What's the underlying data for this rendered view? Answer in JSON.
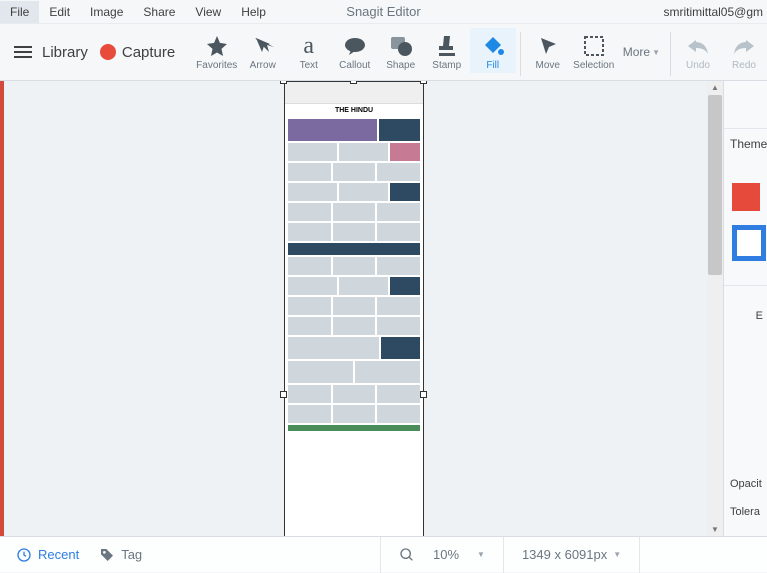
{
  "menubar": {
    "items": [
      "File",
      "Edit",
      "Image",
      "Share",
      "View",
      "Help"
    ],
    "title": "Snagit Editor",
    "user": "smritimittal05@gm"
  },
  "left_tools": {
    "library": "Library",
    "capture": "Capture"
  },
  "tools": [
    {
      "name": "favorites",
      "label": "Favorites"
    },
    {
      "name": "arrow",
      "label": "Arrow"
    },
    {
      "name": "text",
      "label": "Text"
    },
    {
      "name": "callout",
      "label": "Callout"
    },
    {
      "name": "shape",
      "label": "Shape"
    },
    {
      "name": "stamp",
      "label": "Stamp"
    },
    {
      "name": "fill",
      "label": "Fill",
      "active": true
    },
    {
      "name": "move",
      "label": "Move"
    },
    {
      "name": "selection",
      "label": "Selection"
    }
  ],
  "more_label": "More",
  "history": {
    "undo": "Undo",
    "redo": "Redo"
  },
  "side_panel": {
    "theme_label": "Theme",
    "extra": "E",
    "opacity": "Opacit",
    "tolerance": "Tolera"
  },
  "capture": {
    "site_title": "THE HINDU"
  },
  "statusbar": {
    "recent": "Recent",
    "tag": "Tag",
    "zoom": "10%",
    "dimensions": "1349 x 6091px"
  }
}
